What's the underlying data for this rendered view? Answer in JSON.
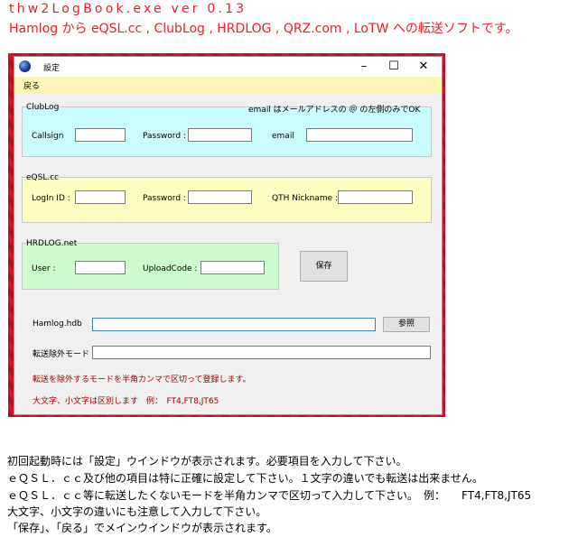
{
  "header": {
    "line1": "thw2LogBook.exe  ver 0.13",
    "line2": "Hamlog から eQSL.cc , ClubLog , HRDLOG , QRZ.com , LoTW への転送ソフトです。"
  },
  "window": {
    "title": "設定",
    "controls": {
      "minimize": "–",
      "maximize": "☐",
      "close": "✕"
    },
    "menu": {
      "back": "戻る"
    },
    "clublog": {
      "title": "ClubLog",
      "note": "email はメールアドレスの ＠ の左側のみでOK",
      "callsign_label": "Callsign",
      "password_label": "Password :",
      "email_label": "email"
    },
    "eqsl": {
      "title": "eQSL.cc",
      "login_label": "LogIn ID :",
      "password_label": "Password :",
      "qth_label": "QTH Nickname :"
    },
    "hrdlog": {
      "title": "HRDLOG.net",
      "user_label": "User :",
      "upload_label": "UploadCode :"
    },
    "save_button": "保存",
    "hamlog_label": "Hamlog.hdb",
    "browse_button": "参照",
    "exclude_label": "転送除外モード",
    "note1": "転送を除外するモードを半角カンマで区切って登録します。",
    "note2": "大文字、小文字は区別します　例：　FT4,FT8,JT65"
  },
  "description": {
    "line1": "初回起動時には「設定」ウインドウが表示されます。必要項目を入力して下さい。",
    "line2": "ｅＱＳＬ．ｃｃ及び他の項目は特に正確に設定して下さい。１文字の違いでも転送は出来ません。",
    "line3": "ｅＱＳＬ．ｃｃ等に転送したくないモードを半角カンマで区切って入力して下さい。　例：　　FT4,FT8,JT65",
    "line4": "大文字、小文字の違いにも注意して入力して下さい。",
    "line5": "「保存」、「戻る」でメインウインドウが表示されます。"
  }
}
